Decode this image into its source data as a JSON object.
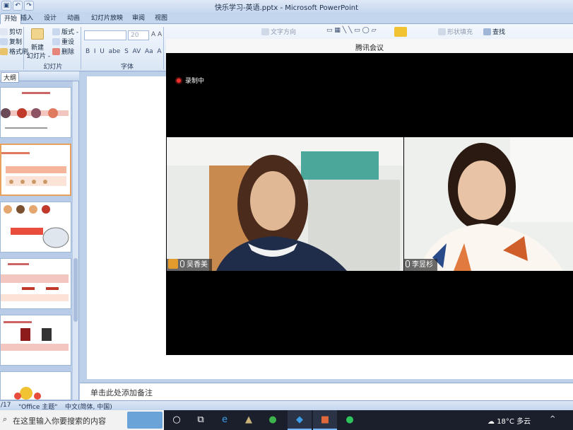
{
  "app": {
    "window_title": "快乐学习-英语.pptx - Microsoft PowerPoint"
  },
  "ribbon": {
    "tabs": [
      "开始",
      "插入",
      "设计",
      "动画",
      "幻灯片放映",
      "审阅",
      "视图"
    ],
    "clipboard": {
      "cut": "剪切",
      "copy": "复制",
      "format_painter": "格式刷"
    },
    "slides": {
      "new_slide": "新建",
      "new_slide_2": "幻灯片 -",
      "layout": "版式 -",
      "reset": "重设",
      "delete": "删除"
    },
    "font": {
      "size": "20"
    },
    "text_direction": "文字方向",
    "shape_fill": "形状填充",
    "find": "查找",
    "group_labels": {
      "slides": "幻灯片",
      "font": "字体"
    }
  },
  "left_pane": {
    "tab_label": "大纲"
  },
  "notes": {
    "placeholder": "单击此处添加备注"
  },
  "statusbar": {
    "slide_count": "/17",
    "theme": "\"Office 主题\"",
    "language": "中文(简体, 中国)"
  },
  "taskbar": {
    "search_placeholder": "在这里输入你要搜索的内容",
    "weather": "18°C 多云"
  },
  "meeting": {
    "title": "腾讯会议",
    "recording": "录制中",
    "participants": [
      {
        "name": "吴香美"
      },
      {
        "name": "李昱杉"
      }
    ]
  },
  "colors": {
    "ribbon_bg": "#dae6f5",
    "meeting_bg": "#000000",
    "record_dot": "#f0312e",
    "avatar_orange": "#e39b2d"
  }
}
